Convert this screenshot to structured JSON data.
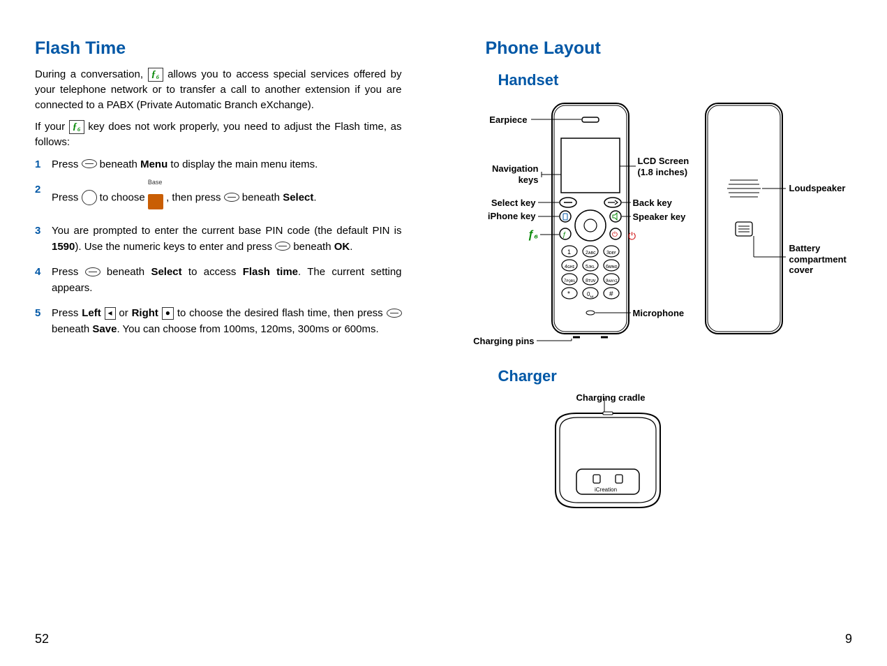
{
  "left": {
    "title": "Flash Time",
    "para1_a": "During a conversation, ",
    "para1_b": " allows you to access special services offered by your telephone network or to transfer a call to another extension if you are connected to a PABX (Private Automatic Branch eXchange).",
    "para2_a": "If your ",
    "para2_b": " key does not work properly, you need to adjust the Flash time, as follows:",
    "steps": {
      "s1_a": "Press ",
      "s1_b": " beneath ",
      "s1_menu": "Menu",
      "s1_c": " to display the main menu items.",
      "s2_a": "Press ",
      "s2_b": " to choose ",
      "s2_base": "Base",
      "s2_c": " , then press ",
      "s2_d": " beneath ",
      "s2_select": "Select",
      "s2_e": ".",
      "s3_a": "You are prompted to enter the current base PIN code (the default PIN is ",
      "s3_pin": "1590",
      "s3_b": "). Use the numeric keys to enter and press ",
      "s3_c": " beneath ",
      "s3_ok": "OK",
      "s3_d": ".",
      "s4_a": "Press ",
      "s4_b": " beneath ",
      "s4_select": "Select",
      "s4_c": " to access ",
      "s4_ft": "Flash time",
      "s4_d": ". The current setting appears.",
      "s5_a": "Press ",
      "s5_left": "Left",
      "s5_b": " or ",
      "s5_right": "Right",
      "s5_c": " to choose the desired flash time, then press ",
      "s5_d": " beneath ",
      "s5_save": "Save",
      "s5_e": ". You can choose from 100ms, 120ms, 300ms or 600ms."
    },
    "page_num": "52"
  },
  "right": {
    "title": "Phone Layout",
    "handset": "Handset",
    "labels": {
      "earpiece": "Earpiece",
      "nav": "Navigation\nkeys",
      "lcd": "LCD Screen\n(1.8 inches)",
      "select": "Select key",
      "iphone": "iPhone key",
      "back": "Back key",
      "speaker": "Speaker key",
      "loud": "Loudspeaker",
      "batt": "Battery\ncompartment\ncover",
      "mic": "Microphone",
      "pins": "Charging pins"
    },
    "charger": "Charger",
    "cradle": "Charging cradle",
    "brand": "iCreation",
    "page_num": "9"
  }
}
